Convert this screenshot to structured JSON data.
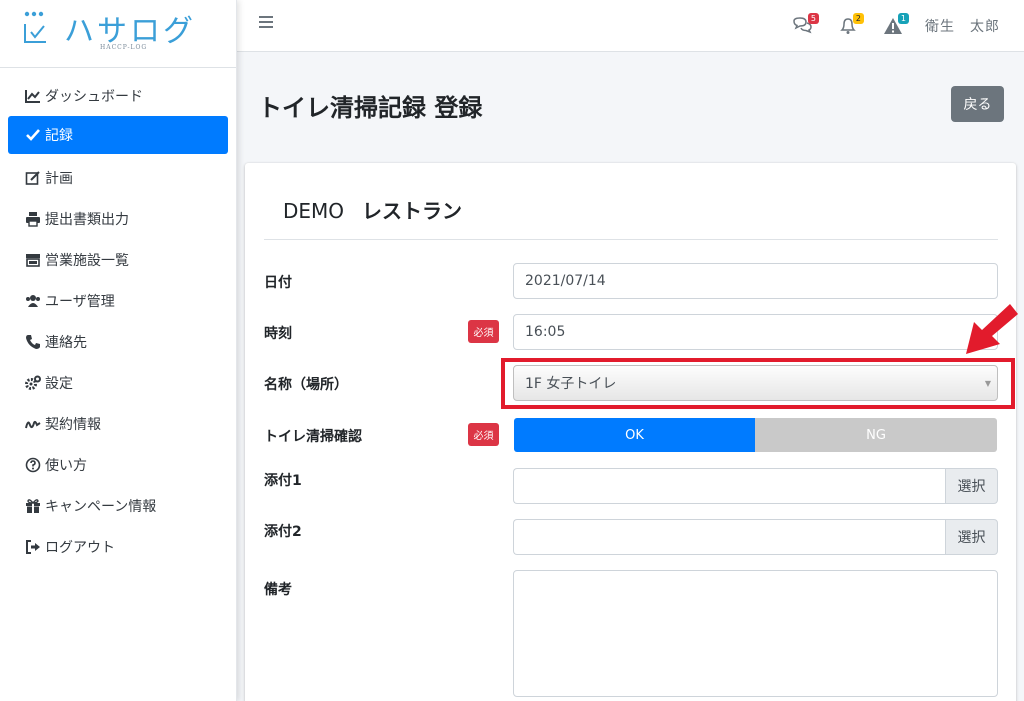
{
  "brand": {
    "name": "ハサログ",
    "sub": "HACCP-LOG"
  },
  "sidebar": {
    "items": [
      {
        "label": "ダッシュボード",
        "icon": "chart-line-icon"
      },
      {
        "label": "記録",
        "icon": "check-icon",
        "active": true
      },
      {
        "label": "計画",
        "icon": "edit-icon"
      },
      {
        "label": "提出書類出力",
        "icon": "print-icon"
      },
      {
        "label": "営業施設一覧",
        "icon": "store-icon"
      },
      {
        "label": "ユーザ管理",
        "icon": "users-icon"
      },
      {
        "label": "連絡先",
        "icon": "phone-icon"
      },
      {
        "label": "設定",
        "icon": "cogs-icon"
      },
      {
        "label": "契約情報",
        "icon": "signature-icon"
      },
      {
        "label": "使い方",
        "icon": "question-circle-icon"
      },
      {
        "label": "キャンペーン情報",
        "icon": "gift-icon"
      },
      {
        "label": "ログアウト",
        "icon": "sign-out-icon"
      }
    ]
  },
  "header": {
    "messages_badge": "5",
    "notifications_badge": "2",
    "alerts_badge": "1",
    "user_name": "衛生　太郎",
    "colors": {
      "messages": "#dc3545",
      "notifications": "#ffc107",
      "alerts": "#17a2b8"
    }
  },
  "page": {
    "title": "トイレ清掃記録 登録",
    "back_label": "戻る"
  },
  "form": {
    "company": "DEMO",
    "restaurant": "レストラン",
    "date_label": "日付",
    "date_value": "2021/07/14",
    "time_label": "時刻",
    "time_value": "16:05",
    "required_label": "必須",
    "location_label": "名称（場所）",
    "location_value": "1F 女子トイレ",
    "check_label": "トイレ清掃確認",
    "ok_label": "OK",
    "ng_label": "NG",
    "check_value": "OK",
    "attach1_label": "添付1",
    "attach2_label": "添付2",
    "select_label": "選択",
    "notes_label": "備考"
  },
  "colors": {
    "primary": "#007bff",
    "danger": "#dc3545",
    "secondary": "#6c757d",
    "highlight": "#e21b2c"
  }
}
